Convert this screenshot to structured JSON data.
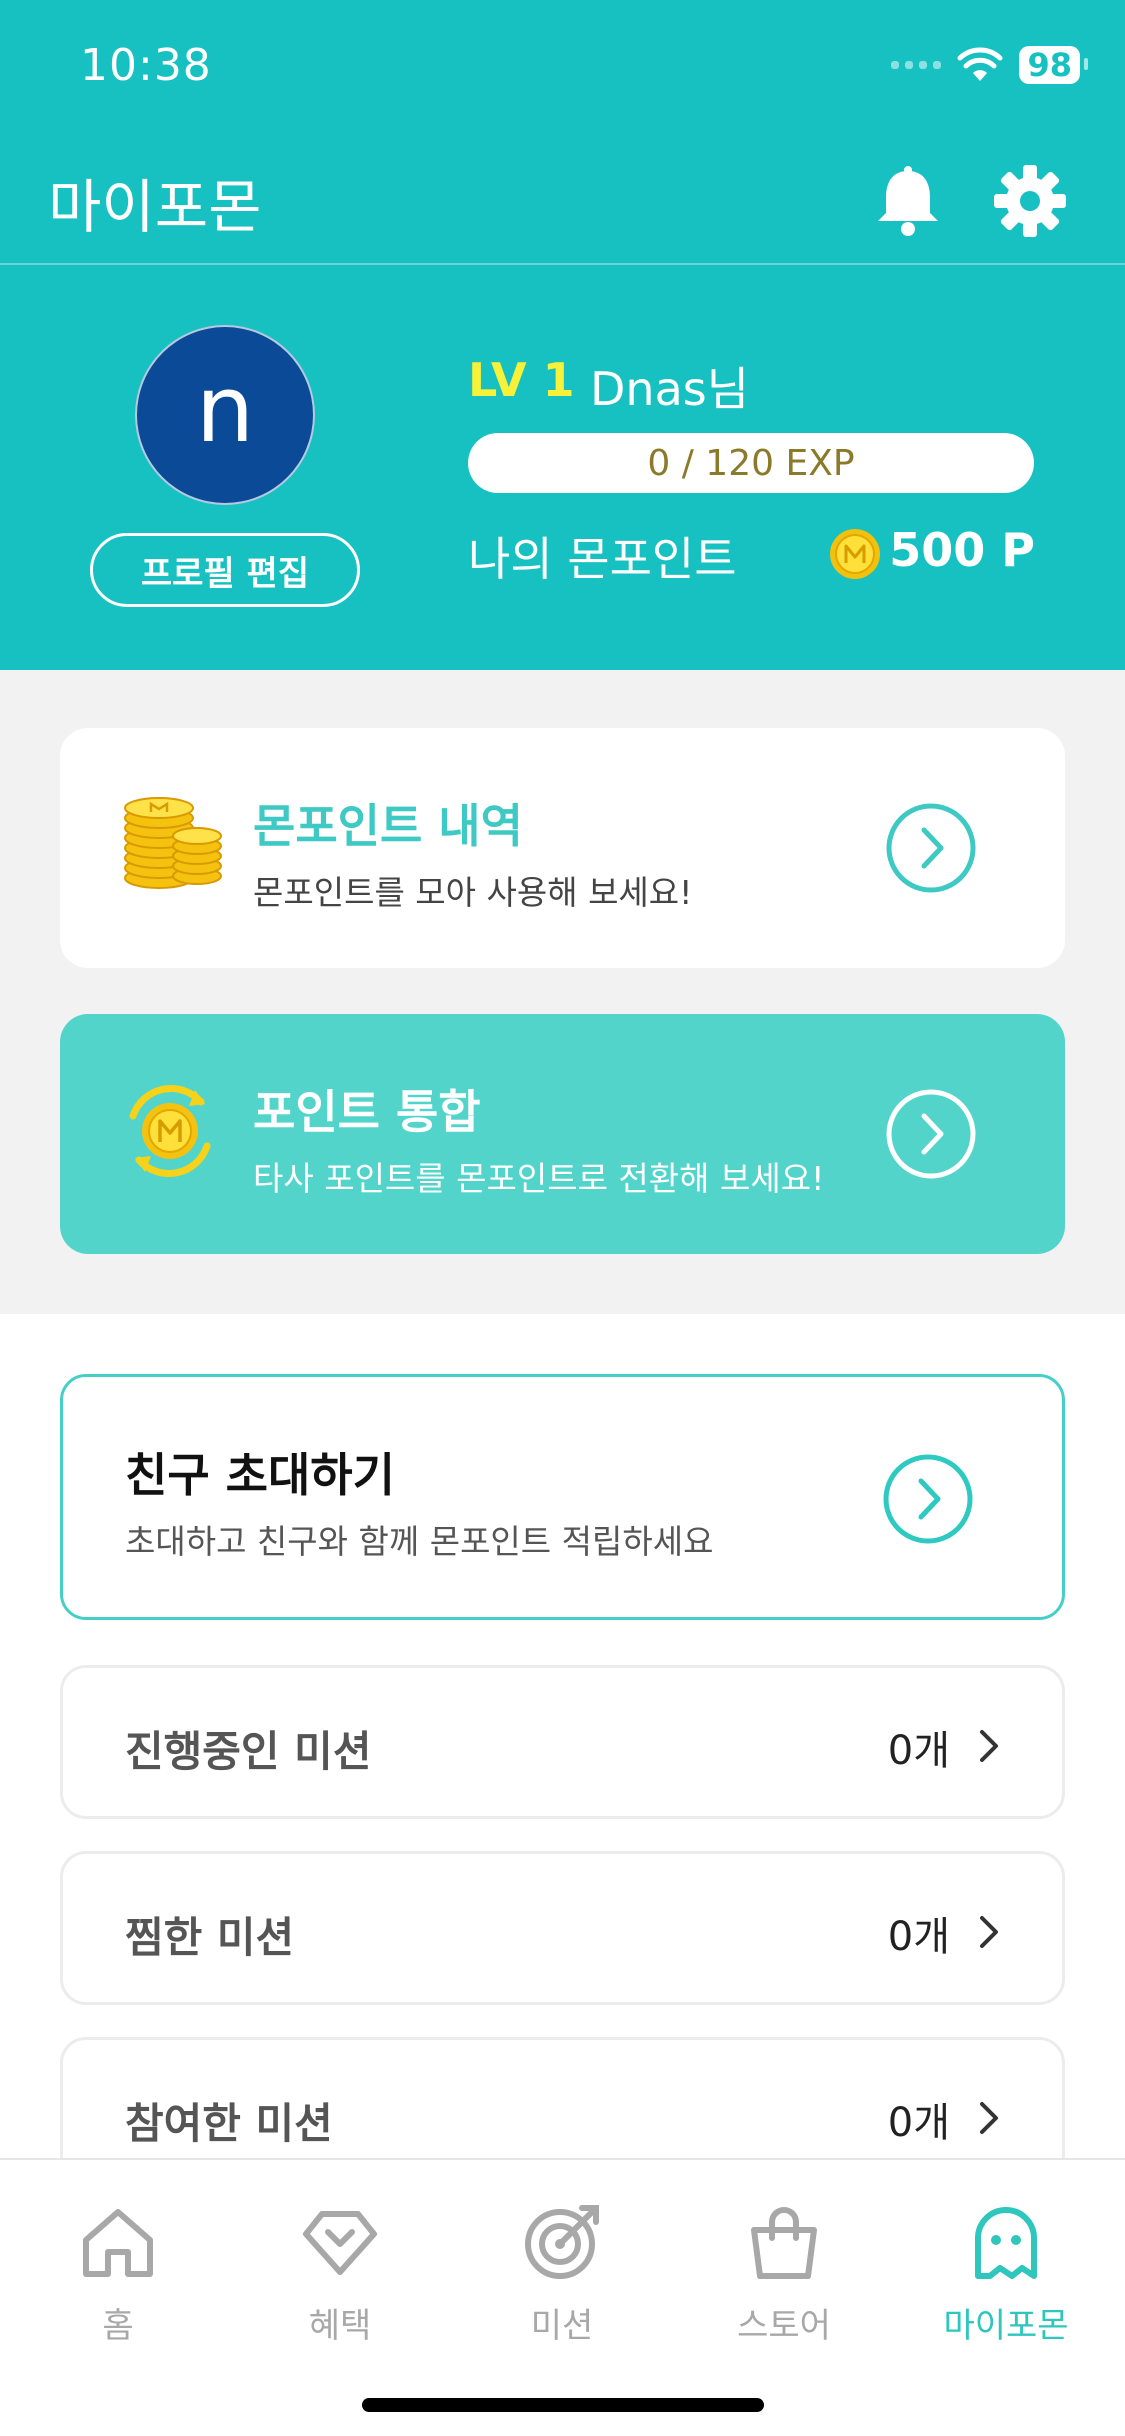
{
  "status": {
    "time": "10:38",
    "battery": "98"
  },
  "header": {
    "title": "마이포몬"
  },
  "profile": {
    "avatar_letter": "n",
    "edit_label": "프로필 편집",
    "level": "LV 1",
    "name": "Dnas님",
    "exp_text": "0 / 120 EXP",
    "exp_progress": 0,
    "point_label": "나의 몬포인트",
    "point_value": "500 P"
  },
  "cards": {
    "history": {
      "title": "몬포인트 내역",
      "subtitle": "몬포인트를 모아 사용해 보세요!"
    },
    "integrate": {
      "title": "포인트 통합",
      "subtitle": "타사 포인트를 몬포인트로 전환해 보세요!"
    }
  },
  "invite": {
    "title": "친구 초대하기",
    "subtitle": "초대하고 친구와 함께 몬포인트 적립하세요"
  },
  "missions": [
    {
      "label": "진행중인 미션",
      "count": "0개"
    },
    {
      "label": "찜한 미션",
      "count": "0개"
    },
    {
      "label": "참여한 미션",
      "count": "0개"
    }
  ],
  "tabs": [
    {
      "label": "홈",
      "icon": "home-icon"
    },
    {
      "label": "혜택",
      "icon": "diamond-icon"
    },
    {
      "label": "미션",
      "icon": "target-icon"
    },
    {
      "label": "스토어",
      "icon": "shopping-bag-icon"
    },
    {
      "label": "마이포몬",
      "icon": "ghost-icon",
      "active": true
    }
  ],
  "colors": {
    "brand": "#17c1c1",
    "accent": "#52d4cb",
    "level": "#f7f13a",
    "tab_active": "#2ec6bd"
  }
}
